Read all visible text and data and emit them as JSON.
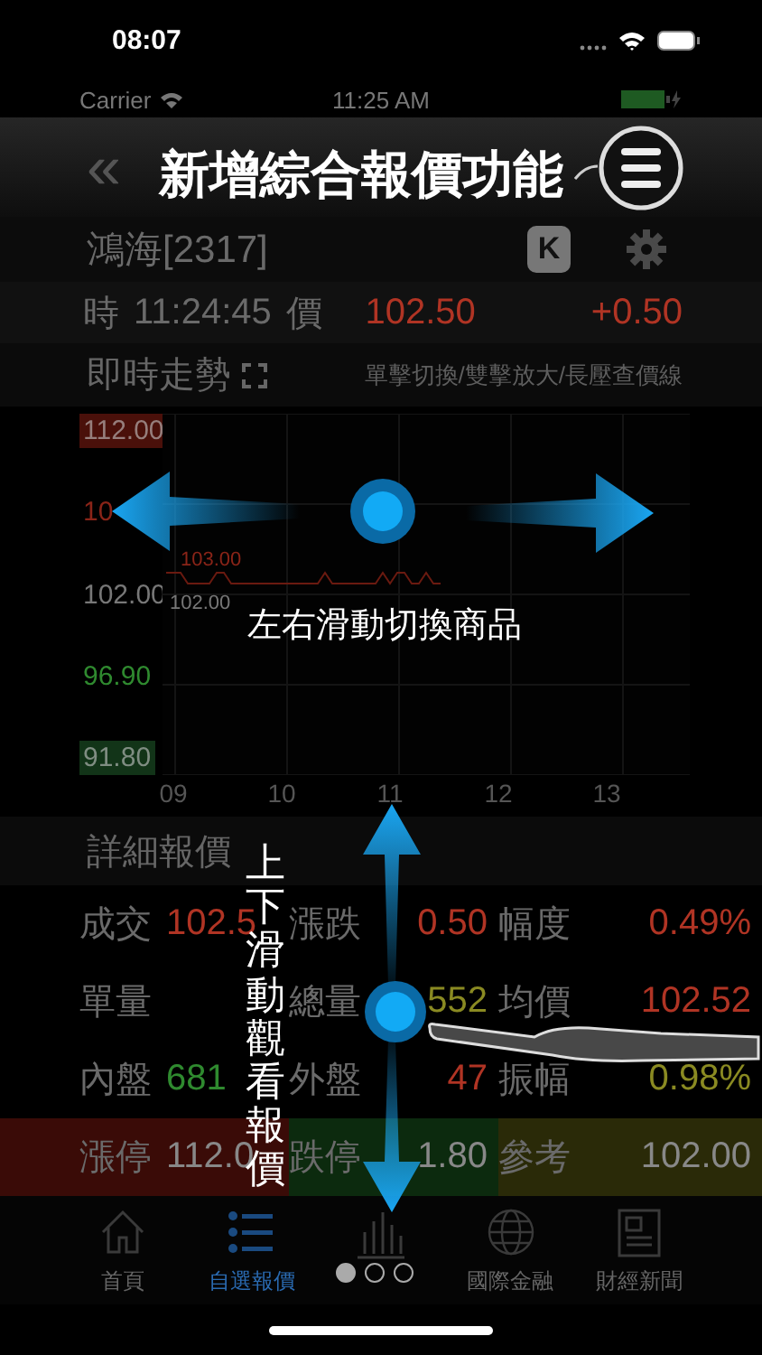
{
  "phone_status": {
    "time": "08:07"
  },
  "app_status": {
    "carrier": "Carrier",
    "time": "11:25 AM"
  },
  "nav": {
    "back": "«"
  },
  "stock": {
    "name": "鴻海[2317]",
    "k_button": "K"
  },
  "quote": {
    "time_label": "時",
    "time": "11:24:45",
    "price_label": "價",
    "price": "102.50",
    "change": "+0.50"
  },
  "trend": {
    "title": "即時走勢",
    "hint": "單擊切換/雙擊放大/長壓查價線"
  },
  "chart": {
    "y_labels": [
      {
        "text": "112.00",
        "color": "#4a100a",
        "boxed": true
      },
      {
        "text": "10",
        "color": "#8a2418",
        "boxed": false
      },
      {
        "text": "102.00",
        "color": "#777777",
        "boxed": false
      },
      {
        "text": "96.90",
        "color": "#2f8a2f",
        "boxed": false
      },
      {
        "text": "91.80",
        "color": "#123418",
        "boxed": true
      }
    ],
    "line_labels": [
      {
        "text": "103.00",
        "color": "#8a2418"
      },
      {
        "text": "102.00",
        "color": "#777777"
      }
    ],
    "x_labels": [
      "09",
      "10",
      "11",
      "12",
      "13"
    ]
  },
  "detail": {
    "title": "詳細報價",
    "rows": [
      {
        "cells": [
          {
            "label": "成交",
            "value": "102.5",
            "color": "#b03424"
          },
          {
            "label": "漲跌",
            "value": "0.50",
            "color": "#b03424"
          },
          {
            "label": "幅度",
            "value": "0.49%",
            "color": "#b03424"
          }
        ]
      },
      {
        "cells": [
          {
            "label": "單量"
          },
          {
            "label": "總量",
            "value": "552",
            "color": "#8a8a22"
          },
          {
            "label": "均價",
            "value": "102.52",
            "color": "#b03424"
          }
        ]
      },
      {
        "cells": [
          {
            "label": "內盤",
            "value": "681",
            "color": "#2f8a2f"
          },
          {
            "label": "外盤",
            "value": "47",
            "color": "#b03424"
          },
          {
            "label": "振幅",
            "value": "0.98%",
            "color": "#8a8a22"
          }
        ]
      },
      {
        "kind": "banded",
        "cells": [
          {
            "label": "漲停",
            "value": "112.0",
            "color": "#888888"
          },
          {
            "label": "跌停",
            "value": "1.80",
            "color": "#888888"
          },
          {
            "label": "參考",
            "value": "102.00",
            "color": "#888888"
          }
        ]
      }
    ]
  },
  "tabs": [
    {
      "label": "首頁",
      "selected": false
    },
    {
      "label": "自選報價",
      "selected": true
    },
    {
      "selected": false
    },
    {
      "label": "國際金融",
      "selected": false
    },
    {
      "label": "財經新聞",
      "selected": false
    }
  ],
  "tutorial": {
    "title": "新增綜合報價功能",
    "horizontal_hint": "左右滑動切換商品",
    "vertical_hint": "上下滑動觀看報價",
    "pages": [
      {
        "selected": true
      },
      {
        "selected": false
      },
      {
        "selected": false
      }
    ]
  }
}
